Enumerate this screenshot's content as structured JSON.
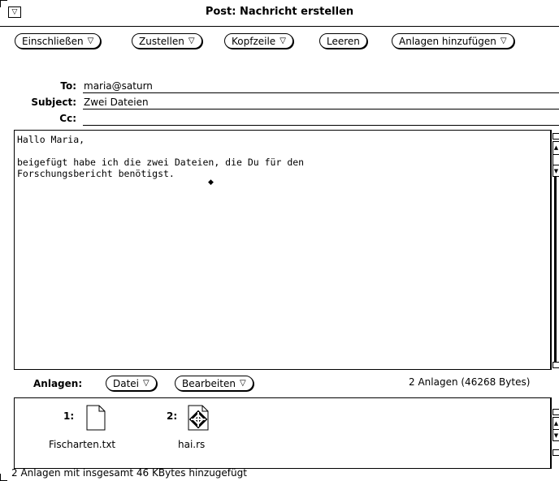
{
  "window": {
    "title": "Post: Nachricht erstellen"
  },
  "toolbar": {
    "buttons": [
      {
        "label": "Einschließen",
        "menu": true
      },
      {
        "label": "Zustellen",
        "menu": true
      },
      {
        "label": "Kopfzeile",
        "menu": true
      },
      {
        "label": "Leeren",
        "menu": false
      },
      {
        "label": "Anlagen hinzufügen",
        "menu": true
      }
    ]
  },
  "header": {
    "to_label": "To:",
    "to_value": "maria@saturn",
    "subject_label": "Subject:",
    "subject_value": "Zwei Dateien",
    "cc_label": "Cc:",
    "cc_value": ""
  },
  "message": {
    "body": "Hallo Maria,\n\nbeigefügt habe ich die zwei Dateien, die Du für den\nForschungsbericht benötigst."
  },
  "attachments": {
    "label": "Anlagen:",
    "datei_button": "Datei",
    "bearbeiten_button": "Bearbeiten",
    "summary": "2 Anlagen (46268 Bytes)",
    "items": [
      {
        "index": "1:",
        "name": "Fischarten.txt",
        "icon": "document-icon"
      },
      {
        "index": "2:",
        "name": "hai.rs",
        "icon": "raster-image-icon"
      }
    ]
  },
  "status": {
    "text": "2 Anlagen mit insgesamt 46 KBytes hinzugefügt"
  }
}
